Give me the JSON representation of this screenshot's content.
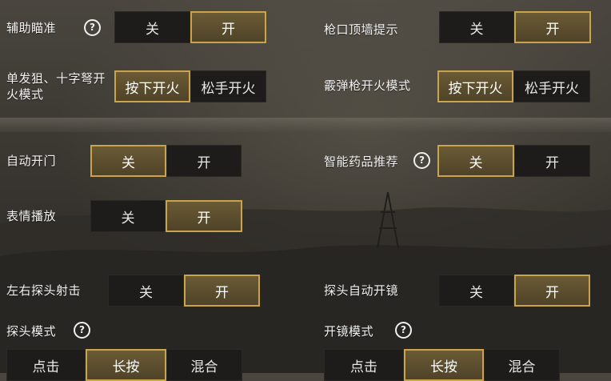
{
  "settings": {
    "aim_assist": {
      "label": "辅助瞄准",
      "options": [
        "关",
        "开"
      ],
      "selected": 1,
      "help": "?"
    },
    "muzzle_hint": {
      "label": "枪口顶墙提示",
      "options": [
        "关",
        "开"
      ],
      "selected": 1
    },
    "sniper_fire": {
      "label": "单发狙、十字弩开火模式",
      "options": [
        "按下开火",
        "松手开火"
      ],
      "selected": 0
    },
    "shotgun_fire": {
      "label": "霰弹枪开火模式",
      "options": [
        "按下开火",
        "松手开火"
      ],
      "selected": 0
    },
    "auto_door": {
      "label": "自动开门",
      "options": [
        "关",
        "开"
      ],
      "selected": 0
    },
    "smart_meds": {
      "label": "智能药品推荐",
      "options": [
        "关",
        "开"
      ],
      "selected": 0,
      "help": "?"
    },
    "emote": {
      "label": "表情播放",
      "options": [
        "关",
        "开"
      ],
      "selected": 1
    },
    "peek_fire": {
      "label": "左右探头射击",
      "options": [
        "关",
        "开"
      ],
      "selected": 1
    },
    "peek_scope": {
      "label": "探头自动开镜",
      "options": [
        "关",
        "开"
      ],
      "selected": 1
    },
    "peek_mode": {
      "label": "探头模式",
      "options": [
        "点击",
        "长按",
        "混合"
      ],
      "selected": 1,
      "help": "?"
    },
    "scope_mode": {
      "label": "开镜模式",
      "options": [
        "点击",
        "长按",
        "混合"
      ],
      "selected": 1,
      "help": "?"
    }
  },
  "colors": {
    "accent": "#c9a44a",
    "selected_fill": "#5c4e2e",
    "unselected_fill": "#1d1c1a"
  },
  "icons": {
    "help": "question-circle-icon"
  }
}
